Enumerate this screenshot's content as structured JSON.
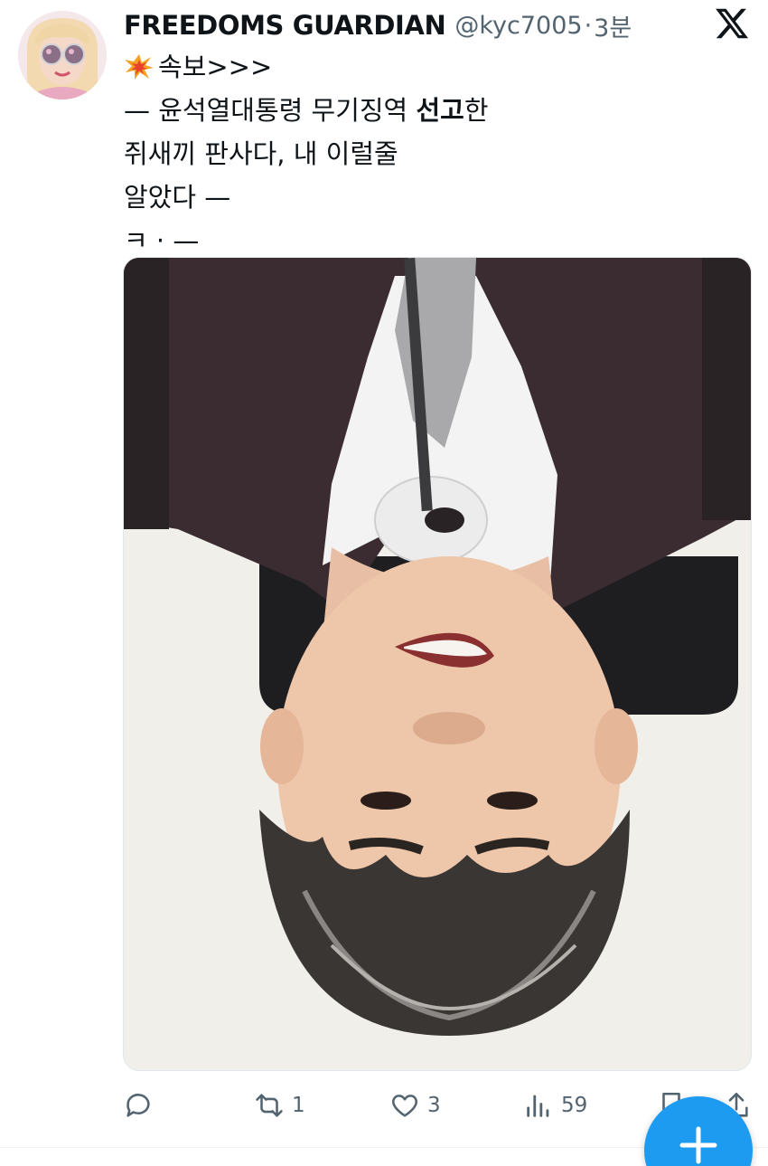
{
  "author": {
    "name": "FREEDOMS GUARDIAN",
    "handle": "@kyc7005",
    "separator": "·",
    "time": "3분"
  },
  "tweet": {
    "line1_text": "속보>>>",
    "line2_prefix": "— 윤석열대통령 무기징역 ",
    "line2_bold": "선고",
    "line2_suffix": "한",
    "line3": "쥐새끼 판사다, 내 이럴줄",
    "line4": "알았다 —",
    "line5": "ㅋ · —"
  },
  "icons": {
    "x_logo": "x-logo-icon",
    "emoji": "collision-emoji-icon",
    "reply": "reply-icon",
    "retweet": "retweet-icon",
    "like": "heart-icon",
    "views": "views-icon",
    "bookmark": "bookmark-icon",
    "share": "share-icon",
    "compose": "plus-icon"
  },
  "actions": {
    "retweet_count": "1",
    "like_count": "3",
    "views_count": "59"
  },
  "colors": {
    "text": "#0f1419",
    "secondary": "#536471",
    "accent": "#1d9bf0"
  }
}
